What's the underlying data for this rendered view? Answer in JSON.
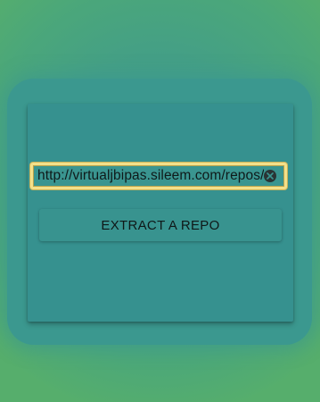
{
  "repo_url": {
    "value": "http://virtualjbipas.sileem.com/repos/",
    "clear_icon": "clear-circle-x-icon"
  },
  "actions": {
    "extract_label": "EXTRACT A REPO"
  },
  "colors": {
    "background": "#4aa57d",
    "card": "#36918f",
    "focus_outline": "#f3e08a"
  }
}
